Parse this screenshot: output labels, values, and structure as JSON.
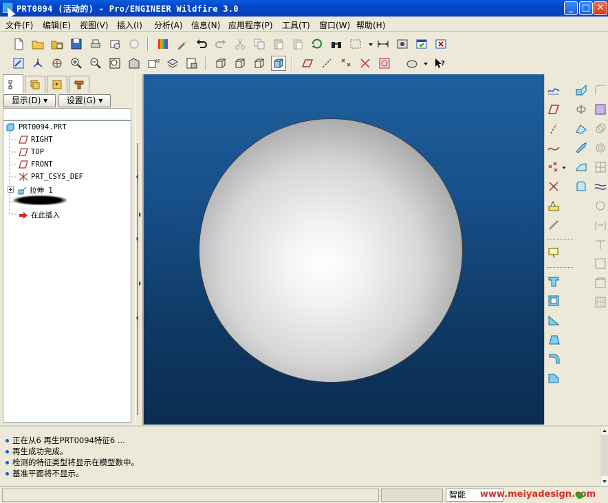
{
  "window": {
    "title": "PRT0094 (活动的) - Pro/ENGINEER Wildfire 3.0",
    "minimize": "_",
    "maximize": "□",
    "close": "✕"
  },
  "menubar": {
    "items": [
      "文件(F)",
      "编辑(E)",
      "视图(V)",
      "插入(I)",
      "分析(A)",
      "信息(N)",
      "应用程序(P)",
      "工具(T)",
      "窗口(W)",
      "帮助(H)"
    ]
  },
  "left_panel": {
    "tabs": [
      "model-tree-tab",
      "layers-tab",
      "favorites-tab",
      "connections-tab"
    ],
    "show_button": "显示(D) ▾",
    "settings_button": "设置(G) ▾",
    "tree": {
      "root": "PRT0094.PRT",
      "items": [
        "RIGHT",
        "TOP",
        "FRONT",
        "PRT_CSYS_DEF",
        "拉伸 1",
        "在此插入"
      ]
    }
  },
  "messages": [
    "正在从6 再生PRT0094特征6 ...",
    "再生成功完成。",
    "检测的特征类型将显示在模型数中。",
    "基准平面将不显示。"
  ],
  "statusbar": {
    "filter": "智能",
    "watermark": "www.meiyadesign.com"
  },
  "colors": {
    "viewport_top": "#1f5f9e",
    "viewport_bottom": "#0b2c4f",
    "title_bar": "#0047c8",
    "watermark": "#d2322d"
  }
}
